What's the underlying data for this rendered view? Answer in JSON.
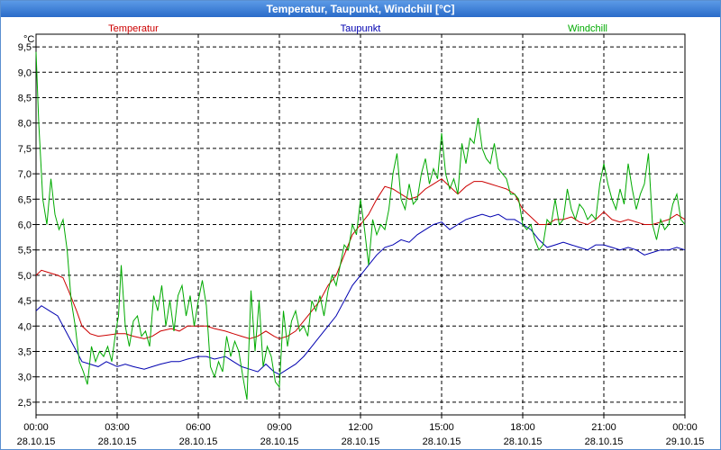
{
  "window": {
    "title": "Temperatur, Taupunkt, Windchill [°C]"
  },
  "chart_data": {
    "type": "line",
    "title": "Temperatur, Taupunkt, Windchill [°C]",
    "ylabel": "°C",
    "ylim": [
      2.25,
      9.75
    ],
    "y_ticks": [
      "9,5",
      "9,0",
      "8,5",
      "8,0",
      "7,5",
      "7,0",
      "6,5",
      "6,0",
      "5,5",
      "5,0",
      "4,5",
      "4,0",
      "3,5",
      "3,0",
      "2,5"
    ],
    "y_tick_values": [
      9.5,
      9.0,
      8.5,
      8.0,
      7.5,
      7.0,
      6.5,
      6.0,
      5.5,
      5.0,
      4.5,
      4.0,
      3.5,
      3.0,
      2.5
    ],
    "xlim": [
      0,
      24
    ],
    "x_ticks": [
      {
        "time": "00:00",
        "date": "28.10.15",
        "h": 0
      },
      {
        "time": "03:00",
        "date": "28.10.15",
        "h": 3
      },
      {
        "time": "06:00",
        "date": "28.10.15",
        "h": 6
      },
      {
        "time": "09:00",
        "date": "28.10.15",
        "h": 9
      },
      {
        "time": "12:00",
        "date": "28.10.15",
        "h": 12
      },
      {
        "time": "15:00",
        "date": "28.10.15",
        "h": 15
      },
      {
        "time": "18:00",
        "date": "28.10.15",
        "h": 18
      },
      {
        "time": "21:00",
        "date": "28.10.15",
        "h": 21
      },
      {
        "time": "00:00",
        "date": "29.10.15",
        "h": 24
      }
    ],
    "grid": true,
    "legend_position": "top",
    "series": [
      {
        "name": "Temperatur",
        "color": "#cc0000",
        "x": [
          0,
          0.2,
          0.5,
          0.8,
          1.0,
          1.2,
          1.5,
          1.7,
          2.0,
          2.3,
          2.6,
          3.0,
          3.3,
          3.6,
          4.0,
          4.3,
          4.6,
          5.0,
          5.3,
          5.6,
          6.0,
          6.3,
          6.6,
          7.0,
          7.3,
          7.6,
          7.9,
          8.2,
          8.5,
          8.8,
          9.0,
          9.3,
          9.6,
          9.9,
          10.2,
          10.5,
          10.8,
          11.1,
          11.4,
          11.7,
          12.0,
          12.3,
          12.6,
          12.9,
          13.2,
          13.5,
          13.8,
          14.1,
          14.4,
          14.7,
          15.0,
          15.3,
          15.6,
          15.9,
          16.2,
          16.5,
          16.8,
          17.1,
          17.4,
          17.7,
          18.0,
          18.3,
          18.6,
          18.9,
          19.2,
          19.5,
          19.8,
          20.1,
          20.4,
          20.7,
          21.0,
          21.3,
          21.6,
          21.9,
          22.2,
          22.5,
          22.8,
          23.1,
          23.4,
          23.7,
          24.0
        ],
        "values": [
          5.0,
          5.1,
          5.05,
          5.0,
          4.95,
          4.7,
          4.3,
          4.0,
          3.85,
          3.8,
          3.82,
          3.85,
          3.85,
          3.8,
          3.75,
          3.8,
          3.9,
          3.95,
          3.9,
          4.0,
          4.0,
          4.0,
          3.95,
          3.9,
          3.85,
          3.8,
          3.75,
          3.8,
          3.9,
          3.8,
          3.75,
          3.8,
          3.9,
          4.1,
          4.3,
          4.5,
          4.8,
          5.0,
          5.4,
          5.8,
          6.0,
          6.2,
          6.5,
          6.75,
          6.7,
          6.6,
          6.5,
          6.55,
          6.7,
          6.8,
          6.9,
          6.75,
          6.6,
          6.75,
          6.85,
          6.85,
          6.8,
          6.75,
          6.7,
          6.6,
          6.3,
          6.15,
          6.0,
          6.0,
          6.1,
          6.1,
          6.15,
          6.05,
          6.0,
          6.1,
          6.25,
          6.1,
          6.05,
          6.1,
          6.05,
          6.0,
          6.0,
          6.05,
          6.1,
          6.2,
          6.1
        ]
      },
      {
        "name": "Taupunkt",
        "color": "#0000b0",
        "x": [
          0,
          0.2,
          0.5,
          0.8,
          1.0,
          1.2,
          1.5,
          1.7,
          2.0,
          2.3,
          2.6,
          3.0,
          3.3,
          3.6,
          4.0,
          4.3,
          4.6,
          5.0,
          5.3,
          5.6,
          6.0,
          6.3,
          6.6,
          7.0,
          7.3,
          7.6,
          7.9,
          8.2,
          8.5,
          8.8,
          9.0,
          9.3,
          9.6,
          9.9,
          10.2,
          10.5,
          10.8,
          11.1,
          11.4,
          11.7,
          12.0,
          12.3,
          12.6,
          12.9,
          13.2,
          13.5,
          13.8,
          14.1,
          14.4,
          14.7,
          15.0,
          15.3,
          15.6,
          15.9,
          16.2,
          16.5,
          16.8,
          17.1,
          17.4,
          17.7,
          18.0,
          18.3,
          18.6,
          18.9,
          19.2,
          19.5,
          19.8,
          20.1,
          20.4,
          20.7,
          21.0,
          21.3,
          21.6,
          21.9,
          22.2,
          22.5,
          22.8,
          23.1,
          23.4,
          23.7,
          24.0
        ],
        "values": [
          4.3,
          4.4,
          4.3,
          4.2,
          4.0,
          3.8,
          3.5,
          3.3,
          3.25,
          3.2,
          3.3,
          3.2,
          3.25,
          3.2,
          3.15,
          3.2,
          3.25,
          3.3,
          3.3,
          3.35,
          3.4,
          3.4,
          3.35,
          3.4,
          3.3,
          3.2,
          3.15,
          3.1,
          3.25,
          3.1,
          3.05,
          3.15,
          3.25,
          3.4,
          3.6,
          3.8,
          4.0,
          4.2,
          4.5,
          4.8,
          5.0,
          5.2,
          5.4,
          5.55,
          5.6,
          5.7,
          5.65,
          5.8,
          5.9,
          6.0,
          6.05,
          5.9,
          6.0,
          6.1,
          6.15,
          6.2,
          6.15,
          6.2,
          6.1,
          6.1,
          6.0,
          5.9,
          5.7,
          5.55,
          5.6,
          5.65,
          5.6,
          5.55,
          5.5,
          5.6,
          5.6,
          5.55,
          5.5,
          5.55,
          5.5,
          5.4,
          5.45,
          5.5,
          5.5,
          5.55,
          5.5
        ]
      },
      {
        "name": "Windchill",
        "color": "#00aa00",
        "x": [
          0,
          0.1,
          0.25,
          0.4,
          0.55,
          0.7,
          0.85,
          1.0,
          1.15,
          1.3,
          1.45,
          1.6,
          1.75,
          1.9,
          2.05,
          2.2,
          2.35,
          2.5,
          2.65,
          2.8,
          2.95,
          3.05,
          3.15,
          3.3,
          3.45,
          3.6,
          3.75,
          3.9,
          4.05,
          4.2,
          4.35,
          4.5,
          4.65,
          4.8,
          4.95,
          5.1,
          5.25,
          5.4,
          5.55,
          5.7,
          5.85,
          6.0,
          6.15,
          6.3,
          6.45,
          6.6,
          6.75,
          6.9,
          7.05,
          7.2,
          7.35,
          7.5,
          7.65,
          7.8,
          7.95,
          8.1,
          8.25,
          8.4,
          8.55,
          8.7,
          8.85,
          9.0,
          9.15,
          9.3,
          9.45,
          9.6,
          9.75,
          9.9,
          10.05,
          10.2,
          10.35,
          10.5,
          10.65,
          10.8,
          10.95,
          11.1,
          11.25,
          11.4,
          11.55,
          11.7,
          11.85,
          12.0,
          12.15,
          12.3,
          12.45,
          12.6,
          12.75,
          12.9,
          13.05,
          13.2,
          13.35,
          13.5,
          13.65,
          13.8,
          13.95,
          14.1,
          14.25,
          14.4,
          14.55,
          14.7,
          14.85,
          15.0,
          15.15,
          15.3,
          15.45,
          15.6,
          15.75,
          15.9,
          16.05,
          16.2,
          16.35,
          16.5,
          16.65,
          16.8,
          16.95,
          17.1,
          17.25,
          17.4,
          17.55,
          17.7,
          17.85,
          18.0,
          18.15,
          18.3,
          18.45,
          18.6,
          18.75,
          18.9,
          19.05,
          19.2,
          19.35,
          19.5,
          19.65,
          19.8,
          19.95,
          20.1,
          20.25,
          20.4,
          20.55,
          20.7,
          20.85,
          21.0,
          21.15,
          21.3,
          21.45,
          21.6,
          21.75,
          21.9,
          22.05,
          22.2,
          22.35,
          22.5,
          22.65,
          22.8,
          22.95,
          23.1,
          23.25,
          23.4,
          23.55,
          23.7,
          23.85,
          24.0
        ],
        "values": [
          9.4,
          8.0,
          6.5,
          6.0,
          6.9,
          6.2,
          5.9,
          6.1,
          5.5,
          4.5,
          4.0,
          3.3,
          3.1,
          2.85,
          3.6,
          3.3,
          3.5,
          3.4,
          3.6,
          3.3,
          3.9,
          4.2,
          5.2,
          4.0,
          3.6,
          4.1,
          4.2,
          3.8,
          3.9,
          3.6,
          4.6,
          4.3,
          4.8,
          4.0,
          4.5,
          3.9,
          4.6,
          4.8,
          4.2,
          4.6,
          4.0,
          4.5,
          4.9,
          4.4,
          3.2,
          3.0,
          3.3,
          3.1,
          3.8,
          3.4,
          3.7,
          3.5,
          3.0,
          2.55,
          4.7,
          3.5,
          4.5,
          3.2,
          3.6,
          3.4,
          2.9,
          2.8,
          4.3,
          3.6,
          4.1,
          4.3,
          3.9,
          4.0,
          3.8,
          4.5,
          4.3,
          4.6,
          4.2,
          4.7,
          5.0,
          4.8,
          5.2,
          5.6,
          5.5,
          6.0,
          5.8,
          6.5,
          5.9,
          5.2,
          6.1,
          5.8,
          6.0,
          5.9,
          6.3,
          7.0,
          7.4,
          6.5,
          6.3,
          6.8,
          6.4,
          6.5,
          7.0,
          7.3,
          6.8,
          7.1,
          6.9,
          7.8,
          7.0,
          6.7,
          6.9,
          6.6,
          7.6,
          7.2,
          7.7,
          7.6,
          8.1,
          7.5,
          7.3,
          7.2,
          7.6,
          7.1,
          7.0,
          6.9,
          6.6,
          6.6,
          6.5,
          6.0,
          5.9,
          6.0,
          5.7,
          5.5,
          5.6,
          6.1,
          6.0,
          6.5,
          6.0,
          6.1,
          6.7,
          6.3,
          6.1,
          6.4,
          6.3,
          6.1,
          6.2,
          6.1,
          6.8,
          7.2,
          6.8,
          6.5,
          6.3,
          6.7,
          6.4,
          7.2,
          6.7,
          6.3,
          6.6,
          6.8,
          7.4,
          6.0,
          5.7,
          6.1,
          5.9,
          6.0,
          6.4,
          6.6,
          6.1,
          6.0
        ]
      }
    ]
  }
}
